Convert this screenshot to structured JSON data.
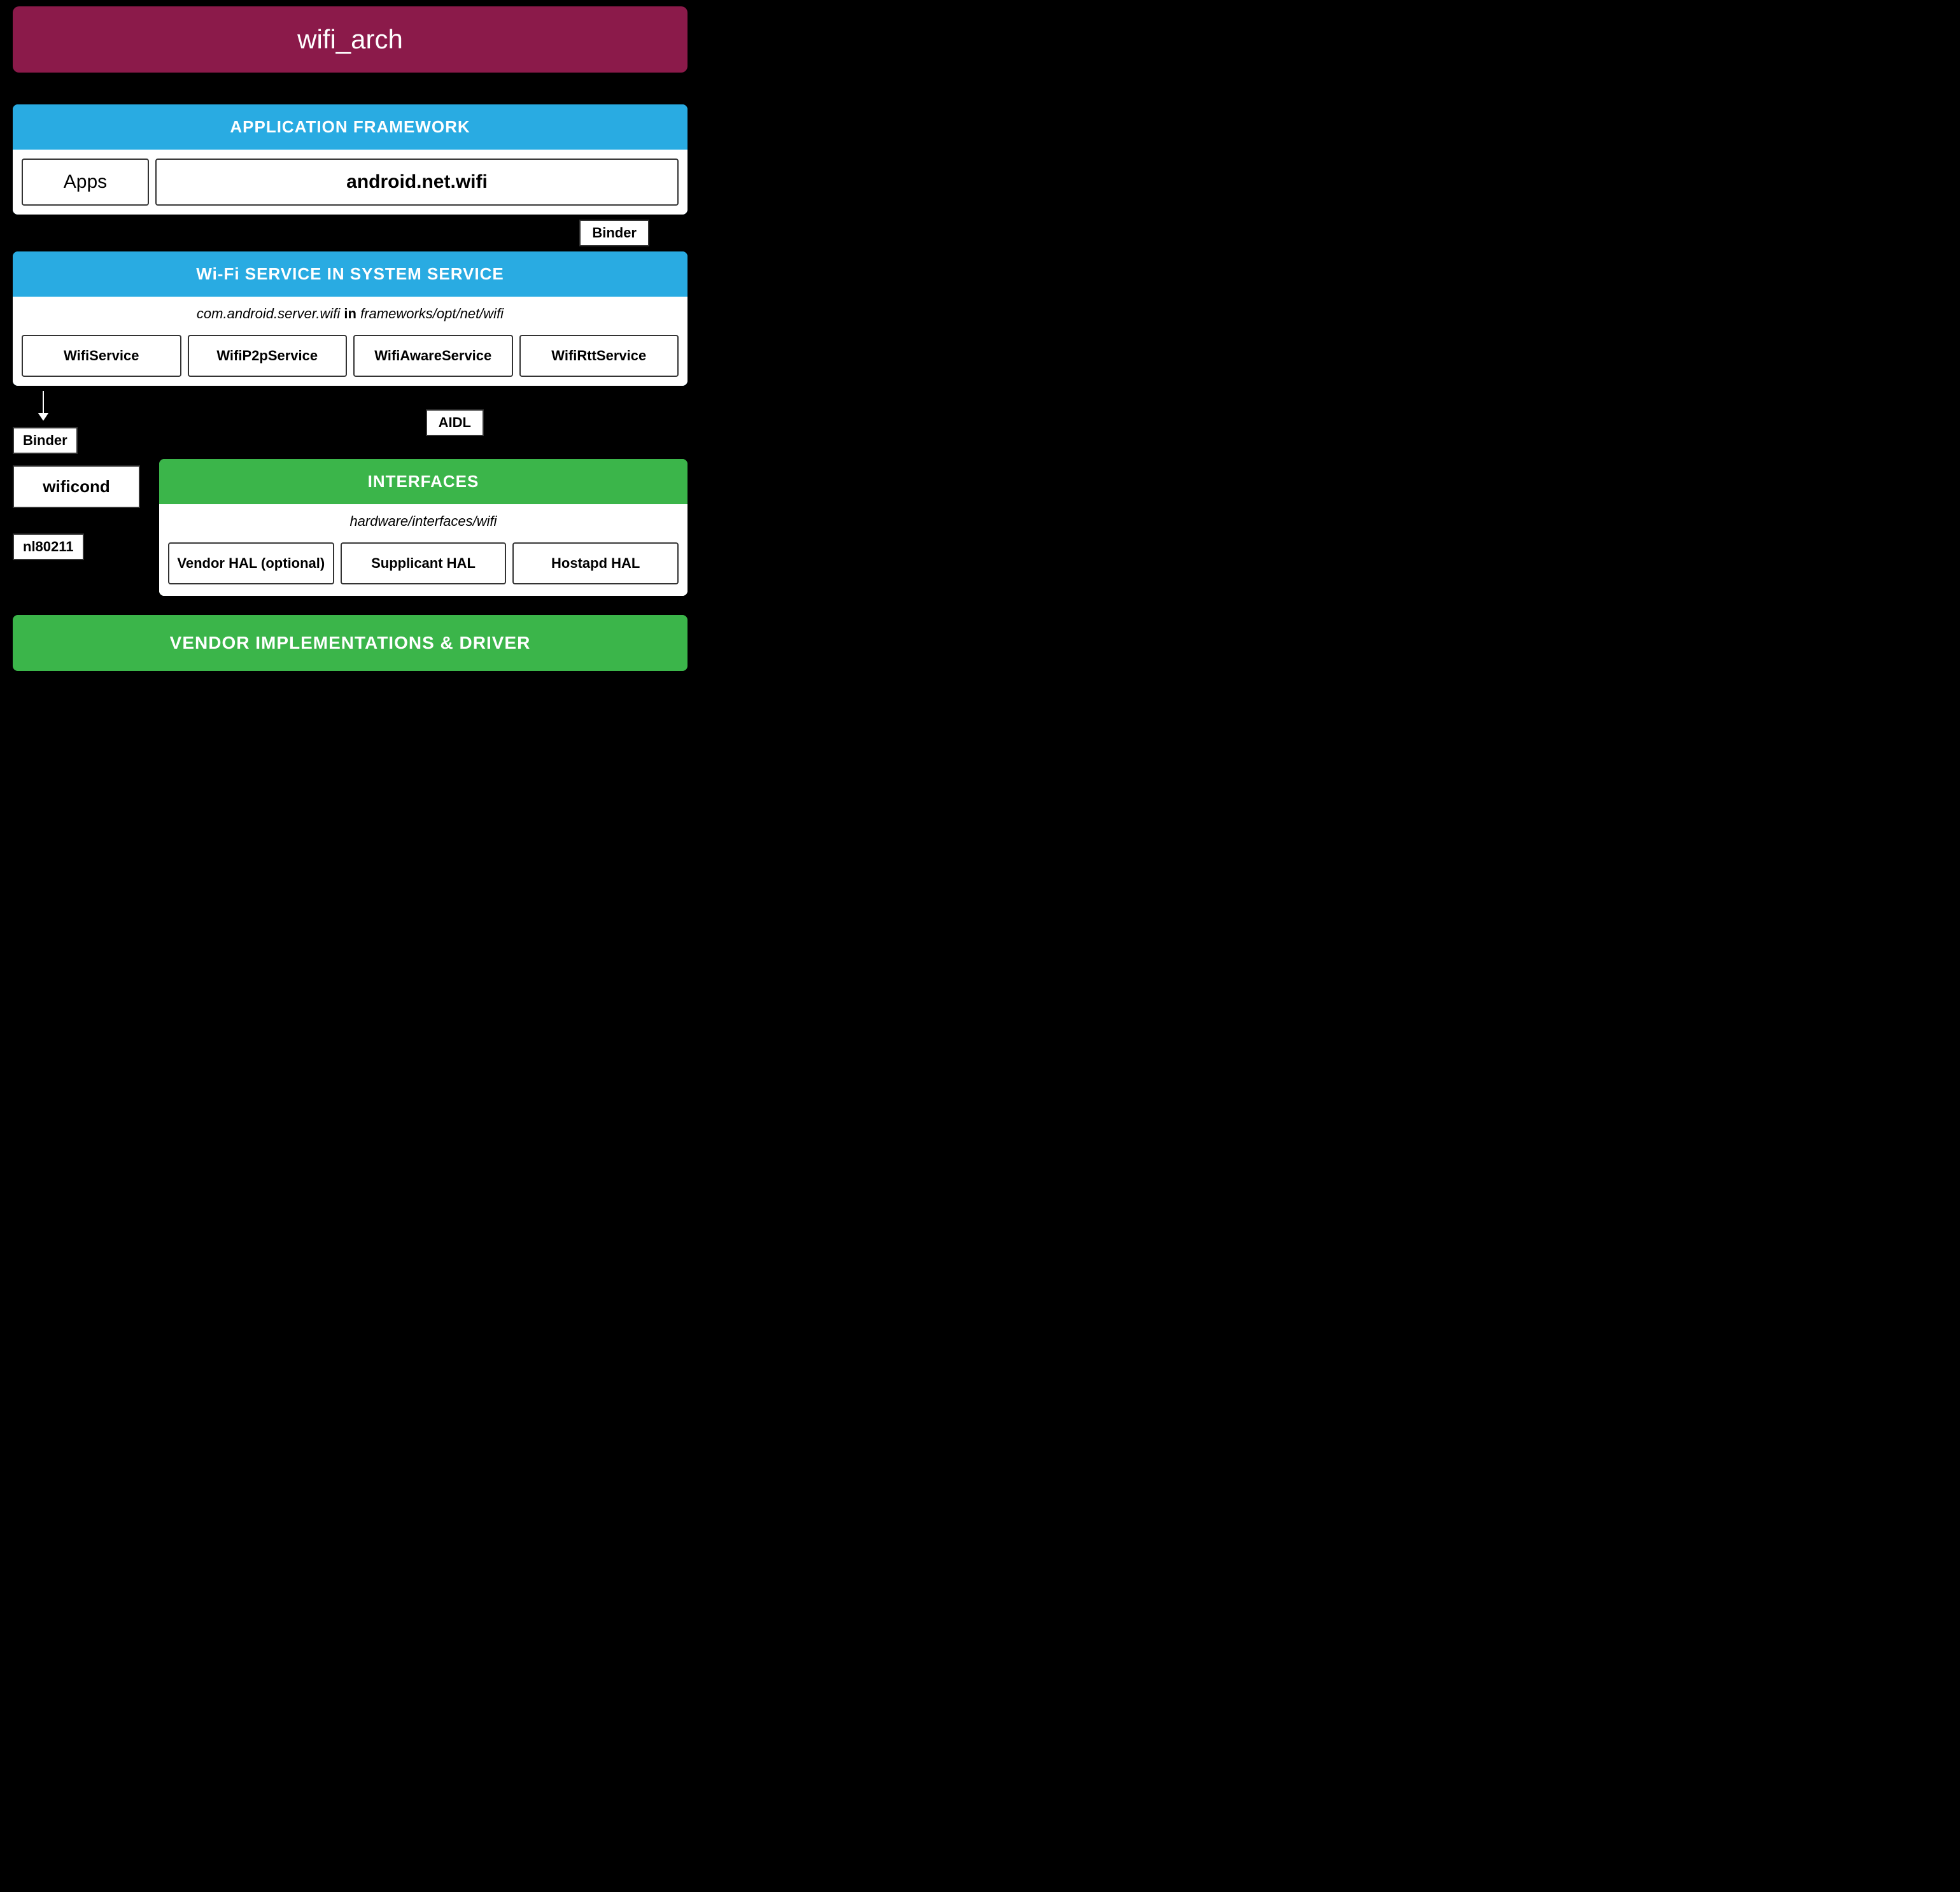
{
  "title": "wifi_arch",
  "titleBg": "#8B1A4A",
  "appFramework": {
    "header": "APPLICATION FRAMEWORK",
    "apps_label": "Apps",
    "android_net_wifi_label": "android.net.wifi",
    "binder_label": "Binder"
  },
  "wifiService": {
    "header": "Wi-Fi SERVICE IN SYSTEM SERVICE",
    "subtitle_italic": "com.android.server.wifi",
    "subtitle_in": "in",
    "subtitle_path": "frameworks/opt/net/wifi",
    "services": [
      {
        "label": "WifiService"
      },
      {
        "label": "WifiP2pService"
      },
      {
        "label": "WifiAwareService"
      },
      {
        "label": "WifiRttService"
      }
    ],
    "binder_label": "Binder",
    "aidl_label": "AIDL"
  },
  "wificond": {
    "label": "wificond",
    "nl80211_label": "nl80211"
  },
  "interfaces": {
    "header": "INTERFACES",
    "subtitle": "hardware/interfaces/wifi",
    "items": [
      {
        "label": "Vendor HAL (optional)"
      },
      {
        "label": "Supplicant HAL"
      },
      {
        "label": "Hostapd HAL"
      }
    ]
  },
  "vendorImpl": {
    "label": "VENDOR IMPLEMENTATIONS & DRIVER"
  }
}
